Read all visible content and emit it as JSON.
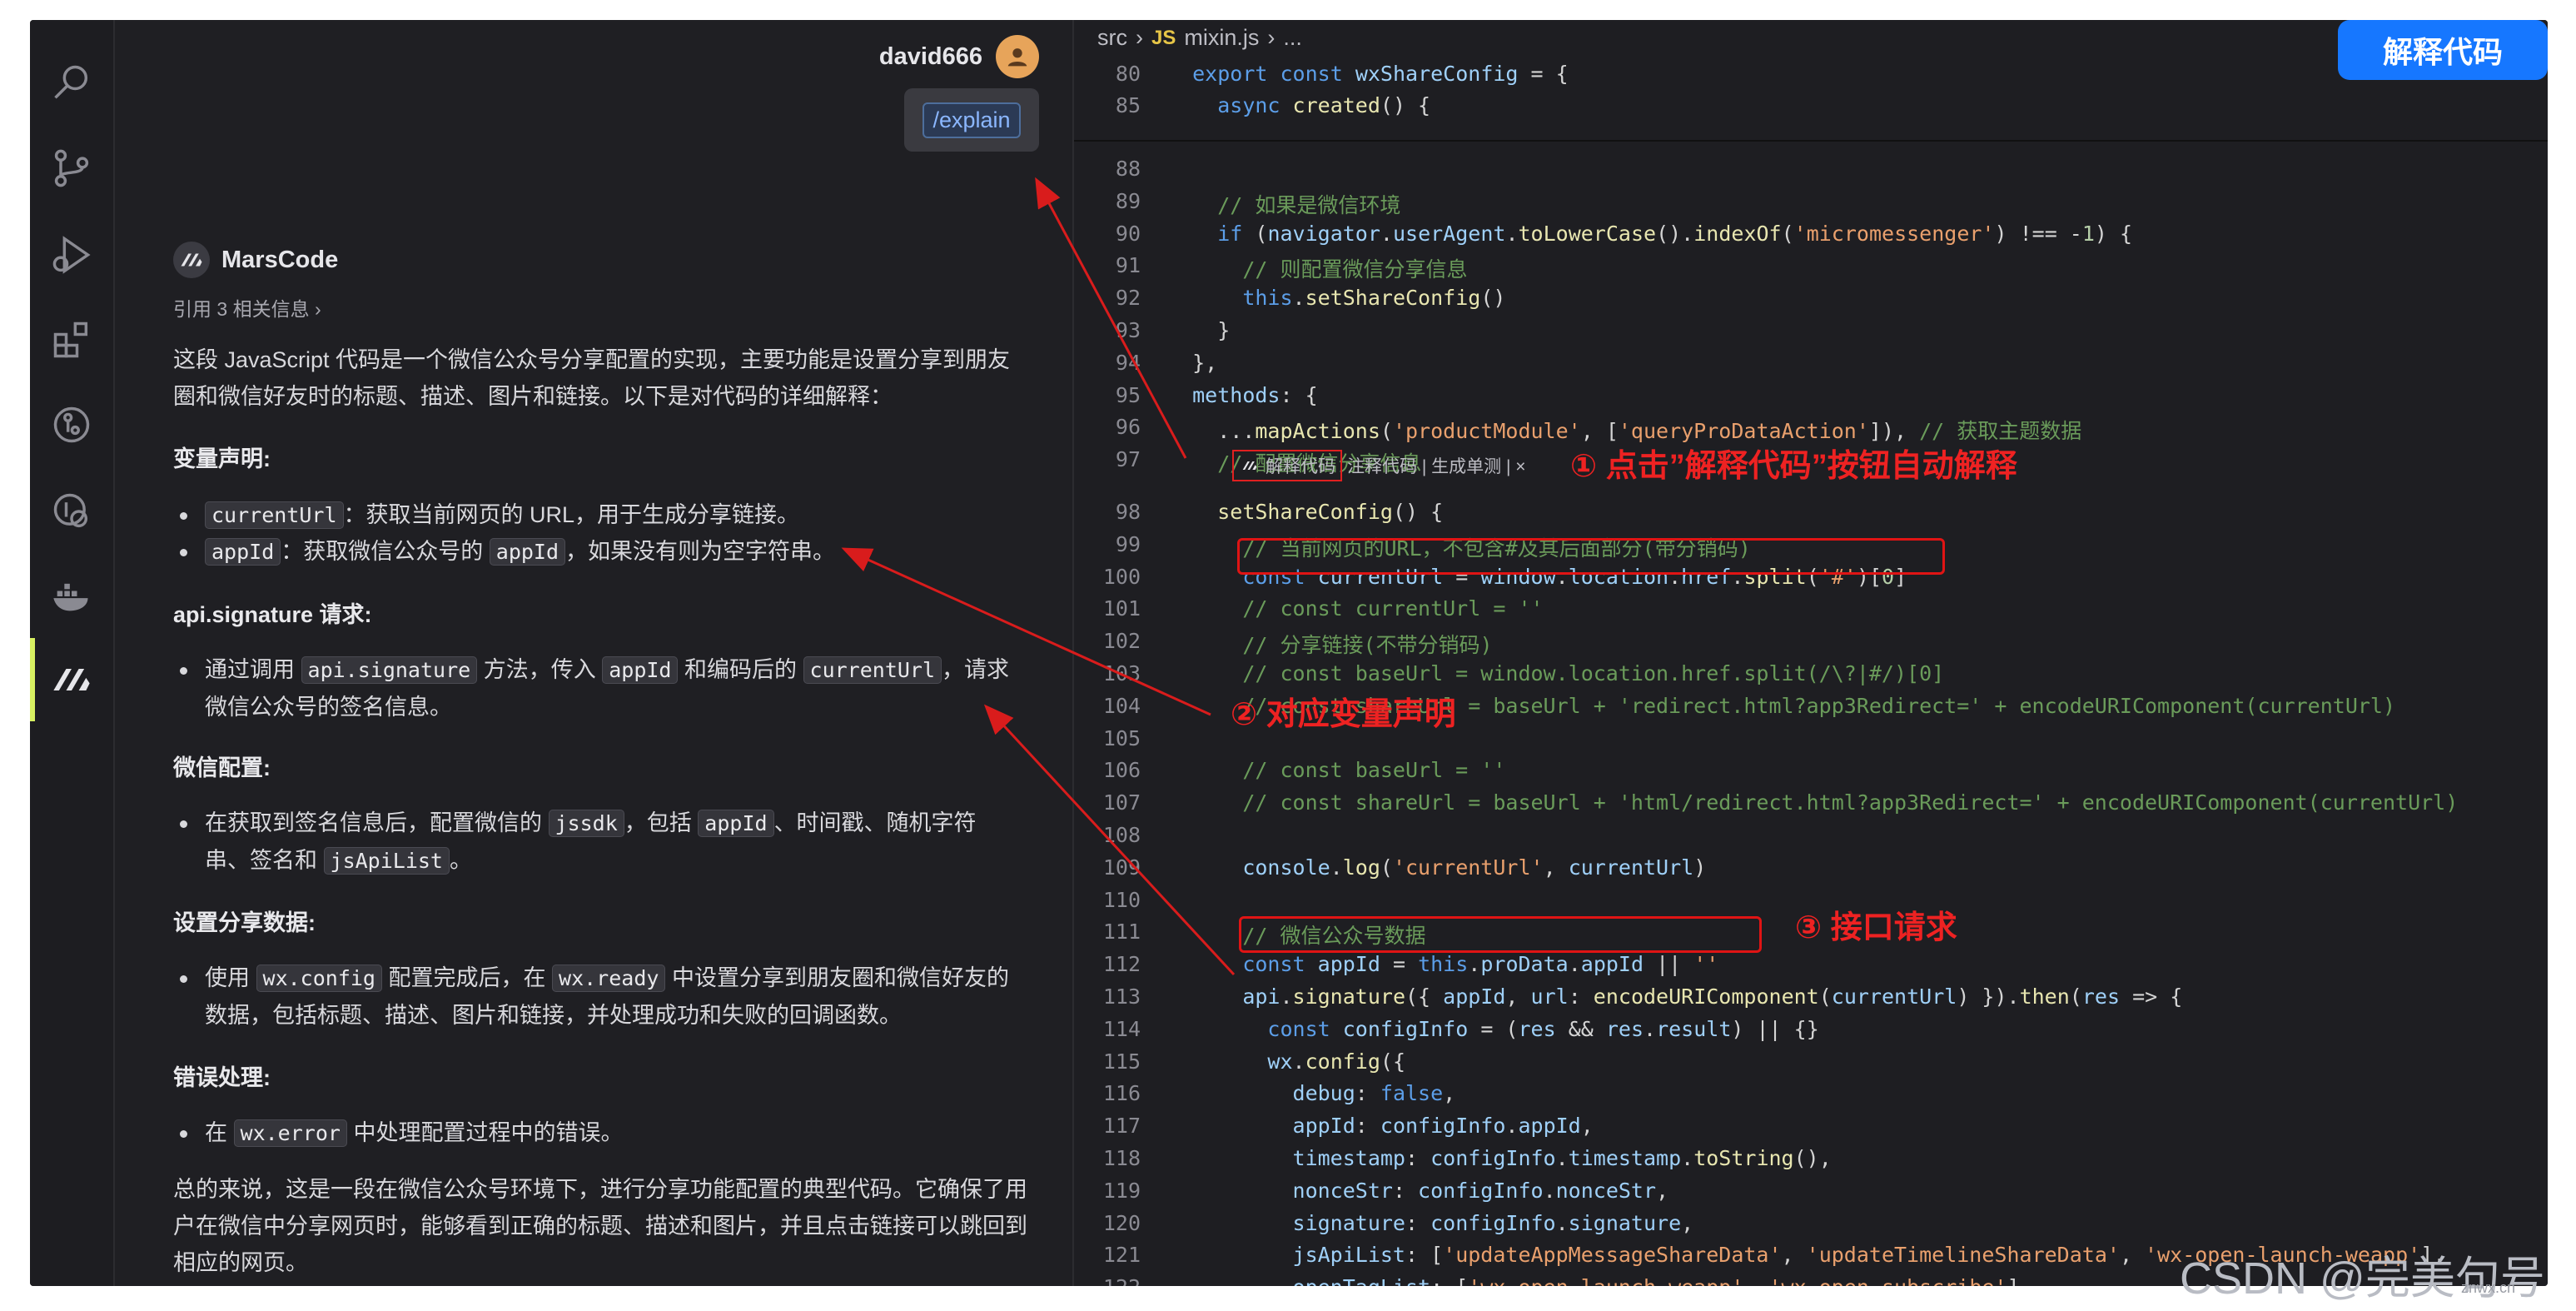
{
  "chat": {
    "user_name": "david666",
    "command": "/explain",
    "bot_name": "MarsCode",
    "references": "引用 3 相关信息 ›",
    "intro_1": "这段 JavaScript 代码是一个微信公众号分享配置的实现，主要功能是设置分享到朋友",
    "intro_2": "圈和微信好友时的标题、描述、图片和链接。以下是对代码的详细解释：",
    "h_vars": "变量声明:",
    "var1_code": "currentUrl",
    "var1_text": "：获取当前网页的 URL，用于生成分享链接。",
    "var2_code": "appId",
    "var2_text_a": "：获取微信公众号的",
    "var2_code2": "appId",
    "var2_text_b": "，如果没有则为空字符串。",
    "h_sig": "api.signature 请求:",
    "sig_a": "通过调用",
    "sig_code1": "api.signature",
    "sig_b": "方法，传入",
    "sig_code2": "appId",
    "sig_c": "和编码后的",
    "sig_code3": "currentUrl",
    "sig_d": "，请求",
    "sig_e": "微信公众号的签名信息。",
    "h_wx": "微信配置:",
    "wx_a": "在获取到签名信息后，配置微信的",
    "wx_code1": "jssdk",
    "wx_b": "，包括",
    "wx_code2": "appId",
    "wx_c": "、时间戳、随机字符",
    "wx_d": "串、签名和",
    "wx_code3": "jsApiList",
    "wx_e": "。",
    "h_share": "设置分享数据:",
    "sh_a": "使用",
    "sh_code1": "wx.config",
    "sh_b": "配置完成后，在",
    "sh_code2": "wx.ready",
    "sh_c": "中设置分享到朋友圈和微信好友的",
    "sh_d": "数据，包括标题、描述、图片和链接，并处理成功和失败的回调函数。",
    "h_err": "错误处理:",
    "err_a": "在",
    "err_code": "wx.error",
    "err_b": "中处理配置过程中的错误。",
    "summary_1": "总的来说，这是一段在微信公众号环境下，进行分享功能配置的典型代码。它确保了用",
    "summary_2": "户在微信中分享网页时，能够看到正确的标题、描述和图片，并且点击链接可以跳回到",
    "summary_3": "相应的网页。"
  },
  "editor": {
    "breadcrumb_src": "src",
    "breadcrumb_js": "JS",
    "breadcrumb_file": "mixin.js",
    "breadcrumb_more": "...",
    "codelens_explain": "解释代码",
    "codelens_rest": "注释代码 | 生成单测 | ×",
    "lines": [
      {
        "n": "88",
        "t": ""
      },
      {
        "n": "89",
        "t": "    // 如果是微信环境"
      },
      {
        "n": "90",
        "t": "    if (navigator.userAgent.toLowerCase().indexOf('micromessenger') !== -1) {"
      },
      {
        "n": "91",
        "t": "      // 则配置微信分享信息"
      },
      {
        "n": "92",
        "t": "      this.setShareConfig()"
      },
      {
        "n": "93",
        "t": "    }"
      },
      {
        "n": "94",
        "t": "  },"
      },
      {
        "n": "95",
        "t": "  methods: {"
      },
      {
        "n": "96",
        "t": "    ...mapActions('productModule', ['queryProDataAction']), // 获取主题数据"
      },
      {
        "n": "97",
        "t": "    // 配置微信分享信息"
      },
      {
        "n": "98",
        "t": "    setShareConfig() {"
      },
      {
        "n": "99",
        "t": "      // 当前网页的URL，不包含#及其后面部分(带分销码)"
      },
      {
        "n": "100",
        "t": "      const currentUrl = window.location.href.split('#')[0]"
      },
      {
        "n": "101",
        "t": "      // const currentUrl = ''"
      },
      {
        "n": "102",
        "t": "      // 分享链接(不带分销码)"
      },
      {
        "n": "103",
        "t": "      // const baseUrl = window.location.href.split(/\\?|#/)[0]"
      },
      {
        "n": "104",
        "t": "      // const shareUrl = baseUrl + 'redirect.html?app3Redirect=' + encodeURIComponent(currentUrl)"
      },
      {
        "n": "105",
        "t": ""
      },
      {
        "n": "106",
        "t": "      // const baseUrl = ''"
      },
      {
        "n": "107",
        "t": "      // const shareUrl = baseUrl + 'html/redirect.html?app3Redirect=' + encodeURIComponent(currentUrl)"
      },
      {
        "n": "108",
        "t": ""
      },
      {
        "n": "109",
        "t": "      console.log('currentUrl', currentUrl)"
      },
      {
        "n": "110",
        "t": ""
      },
      {
        "n": "111",
        "t": "      // 微信公众号数据"
      },
      {
        "n": "112",
        "t": "      const appId = this.proData.appId || ''"
      },
      {
        "n": "113",
        "t": "      api.signature({ appId, url: encodeURIComponent(currentUrl) }).then(res => {"
      },
      {
        "n": "114",
        "t": "        const configInfo = (res && res.result) || {}"
      },
      {
        "n": "115",
        "t": "        wx.config({"
      },
      {
        "n": "116",
        "t": "          debug: false,"
      },
      {
        "n": "117",
        "t": "          appId: configInfo.appId,"
      },
      {
        "n": "118",
        "t": "          timestamp: configInfo.timestamp.toString(),"
      },
      {
        "n": "119",
        "t": "          nonceStr: configInfo.nonceStr,"
      },
      {
        "n": "120",
        "t": "          signature: configInfo.signature,"
      },
      {
        "n": "121",
        "t": "          jsApiList: ['updateAppMessageShareData', 'updateTimelineShareData', 'wx-open-launch-weapp'],"
      },
      {
        "n": "122",
        "t": "          openTagList: ['wx-open-launch-weapp', 'wx-open-subscribe']"
      }
    ],
    "sticky": [
      {
        "n": "80",
        "t": "  export const wxShareConfig = {"
      },
      {
        "n": "85",
        "t": "    async created() {"
      }
    ]
  },
  "annotations": {
    "a1": "①  点击”解释代码”按钮自动解释",
    "a2": "②  对应变量声明",
    "a3": "③    接口请求"
  },
  "explain_button": "解释代码",
  "watermark": "CSDN @完美句号",
  "watermark_small": "znwx.cn",
  "colors": {
    "accent_blue": "#1677ff",
    "annotation_red": "#e01414",
    "active_green": "#d7f061"
  }
}
